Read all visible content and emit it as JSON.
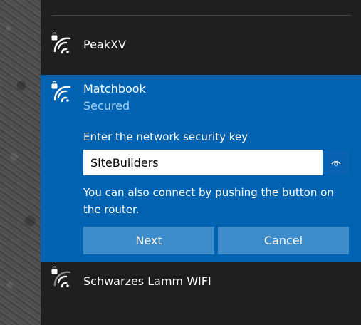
{
  "networks": {
    "peak": {
      "name": "PeakXV",
      "icon": "wifi-secured-icon"
    },
    "selected": {
      "name": "Matchbook",
      "status": "Secured",
      "icon": "wifi-secured-icon",
      "prompt": "Enter the network security key",
      "password": "SiteBuilders",
      "reveal_icon": "eye-icon",
      "hint": "You can also connect by pushing the button on the router.",
      "next_label": "Next",
      "cancel_label": "Cancel"
    },
    "schwarzes": {
      "name": "Schwarzes Lamm WIFI",
      "icon": "wifi-secured-icon"
    }
  },
  "colors": {
    "panel_background": "#1f1f1f",
    "selected_background": "#0063b1",
    "secondary_text": "#a9d2f1",
    "button_background": "#3d8ccb"
  }
}
